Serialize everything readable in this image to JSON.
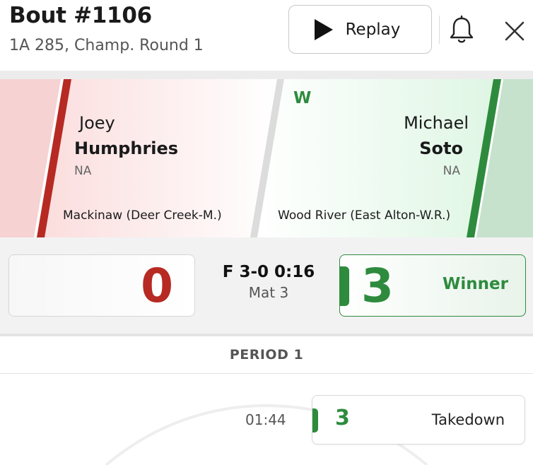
{
  "header": {
    "title": "Bout #1106",
    "subtitle": "1A 285, Champ. Round 1",
    "replay_label": "Replay",
    "icons": [
      "play-icon",
      "bell-icon",
      "close-icon"
    ]
  },
  "wrestlers": {
    "left": {
      "first_name": "Joey",
      "last_name": "Humphries",
      "grade": "NA",
      "team": "Mackinaw (Deer Creek-M.)",
      "color": "#b62a23"
    },
    "right": {
      "first_name": "Michael",
      "last_name": "Soto",
      "grade": "NA",
      "team": "Wood River (East Alton-W.R.)",
      "badge": "W",
      "color": "#2e8b3e"
    }
  },
  "score": {
    "left": "0",
    "right": "3",
    "result": "F 3-0 0:16",
    "mat": "Mat 3",
    "winner_label": "Winner"
  },
  "timeline": {
    "period_label": "PERIOD 1",
    "events": [
      {
        "time": "01:44",
        "points": "3",
        "description": "Takedown"
      }
    ]
  }
}
